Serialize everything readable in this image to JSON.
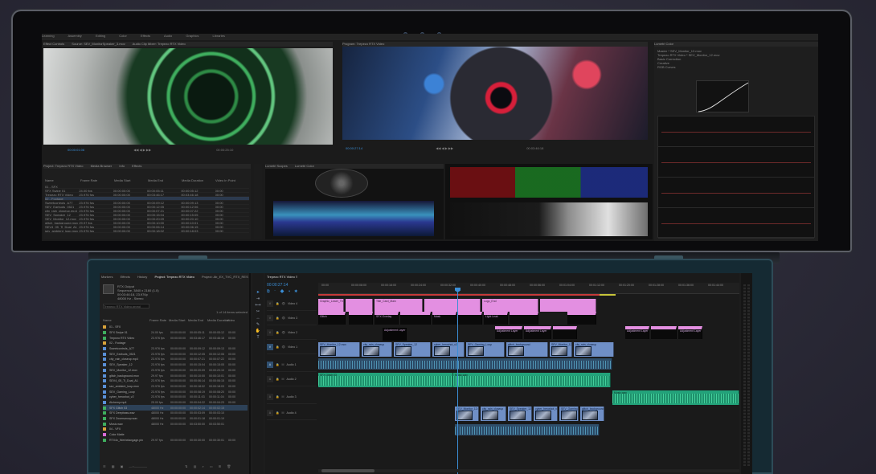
{
  "top_screen": {
    "menu_items": [
      "Learning",
      "Assembly",
      "Editing",
      "Color",
      "Effects",
      "Audio",
      "Graphics",
      "Libraries"
    ],
    "source_tabs": [
      "Effect Controls",
      "Source: SEV_MonitorSpeaker_3.mov",
      "Audio Clip Mixer: Trepezo RTX Video"
    ],
    "program_tab": "Program: Trepezo RTX Video",
    "source_timecode": "00:00:01:06",
    "source_end": "00:00:25:10",
    "program_timecode": "00:00:27:14",
    "program_end": "00:03:46:18",
    "lumetri_tab": "Lumetri Color",
    "lumetri_fields": [
      "Master * SEV_Monitor_12.mov",
      "Trepezo RTX Video * SEV_Monitor_12.mov",
      "Basic Correction",
      "Creative",
      "RGB Curves"
    ],
    "project_tabs": [
      "Project: Trepezo RTX Video",
      "Media Browser",
      "Info",
      "Effects"
    ],
    "project_columns": [
      "Name",
      "Frame Rate",
      "Media Start",
      "Media End",
      "Media Duration",
      "Video In Point"
    ],
    "scopes_tabs": [
      "Lumetri Scopes",
      "Lumetri Color"
    ]
  },
  "project": {
    "tabs": [
      "Markers",
      "Effects",
      "History",
      "Project: Trepezo RTX Video",
      "Project: Ab_EX_TVC_RTX_RES"
    ],
    "active_tab": 3,
    "info_lines": [
      "RTX Output",
      "Sequence, 3840 x 2160 (1.0)",
      "00:03:46:18, 23.976p",
      "48000 Hz - Stereo"
    ],
    "search_placeholder": "Trepezo RTX Video.prproj",
    "item_count": "1 of 14 items selected",
    "columns": [
      "Name",
      "Frame Rate",
      "Media Start",
      "Media End",
      "Media Duration",
      "Video"
    ],
    "rows": [
      {
        "name": "01 - SFX",
        "fr": "",
        "ms": "",
        "me": "",
        "md": "",
        "v": "",
        "color": "#d9a23a",
        "sel": false
      },
      {
        "name": "SFX Swipe 01",
        "fr": "24.00 fps",
        "ms": "00:00:00:00",
        "me": "00:00:05:11",
        "md": "00:00:05:12",
        "v": "00:00",
        "color": "#3fae5e",
        "sel": false
      },
      {
        "name": "Trepezo RTX Video",
        "fr": "23.976 fps",
        "ms": "00:00:00:00",
        "me": "00:03:46:17",
        "md": "00:03:46:18",
        "v": "00:00",
        "color": "#3fae5e",
        "sel": false
      },
      {
        "name": "02 - Footage",
        "fr": "",
        "ms": "",
        "me": "",
        "md": "",
        "v": "",
        "color": "#d9a23a",
        "sel": false
      },
      {
        "name": "Sweetcontrols_A77",
        "fr": "23.976 fps",
        "ms": "00:00:00:00",
        "me": "00:00:09:12",
        "md": "00:00:09:13",
        "v": "00:00",
        "color": "#5a8fd6",
        "sel": false
      },
      {
        "name": "SEV_Earbuds_0521",
        "fr": "23.976 fps",
        "ms": "00:00:00:00",
        "me": "00:00:12:05",
        "md": "00:00:12:06",
        "v": "00:00",
        "color": "#5a8fd6",
        "sel": false
      },
      {
        "name": "city_rain_closeup.mp4",
        "fr": "23.976 fps",
        "ms": "00:00:00:00",
        "me": "00:00:07:21",
        "md": "00:00:07:22",
        "v": "00:00",
        "color": "#5a8fd6",
        "sel": false
      },
      {
        "name": "SEV_Speaker_12",
        "fr": "23.976 fps",
        "ms": "00:00:00:00",
        "me": "00:00:15:04",
        "md": "00:00:15:05",
        "v": "00:00",
        "color": "#5a8fd6",
        "sel": false
      },
      {
        "name": "SEV_Monitor_12.mov",
        "fr": "23.976 fps",
        "ms": "00:00:00:00",
        "me": "00:00:20:09",
        "md": "00:00:20:10",
        "v": "00:00",
        "color": "#5a8fd6",
        "sel": false
      },
      {
        "name": "glitch_background.mov",
        "fr": "29.97 fps",
        "ms": "00:00:00:00",
        "me": "00:00:10:00",
        "md": "00:00:10:01",
        "v": "00:00",
        "color": "#5a8fd6",
        "sel": false
      },
      {
        "name": "SEV4_05_Ti_Dual_A1",
        "fr": "23.976 fps",
        "ms": "00:00:00:00",
        "me": "00:00:06:14",
        "md": "00:00:06:15",
        "v": "00:00",
        "color": "#5a8fd6",
        "sel": false
      },
      {
        "name": "sev_ambient_loop.mov",
        "fr": "23.976 fps",
        "ms": "00:00:00:00",
        "me": "00:00:18:02",
        "md": "00:00:18:03",
        "v": "00:00",
        "color": "#5a8fd6",
        "sel": false
      },
      {
        "name": "SEV_Gaming_Loop",
        "fr": "23.976 fps",
        "ms": "00:00:00:00",
        "me": "00:00:08:19",
        "md": "00:00:08:20",
        "v": "00:00",
        "color": "#5a8fd6",
        "sel": false
      },
      {
        "name": "cyber_heroshot_v2",
        "fr": "23.976 fps",
        "ms": "00:00:00:00",
        "me": "00:00:11:03",
        "md": "00:00:11:04",
        "v": "00:00",
        "color": "#5a8fd6",
        "sel": false
      },
      {
        "name": "Alchemy.mp4",
        "fr": "25.00 fps",
        "ms": "00:00:00:00",
        "me": "00:00:04:22",
        "md": "00:00:04:23",
        "v": "00:00",
        "color": "#5a8fd6",
        "sel": false
      },
      {
        "name": "SFX Glitch 03",
        "fr": "48000 Hz",
        "ms": "00:00:00:00",
        "me": "00:00:02:14",
        "md": "00:00:02:15",
        "v": "",
        "color": "#3fae5e",
        "sel": true
      },
      {
        "name": "SFX Deepbass.wav",
        "fr": "48000 Hz",
        "ms": "00:00:00:00",
        "me": "00:00:03:09",
        "md": "00:00:03:10",
        "v": "",
        "color": "#3fae5e",
        "sel": false
      },
      {
        "name": "SFX Zoomswoop.wav",
        "fr": "48000 Hz",
        "ms": "00:00:00:00",
        "me": "00:00:01:18",
        "md": "00:00:01:19",
        "v": "",
        "color": "#3fae5e",
        "sel": false
      },
      {
        "name": "Music.wav",
        "fr": "48000 Hz",
        "ms": "00:00:00:00",
        "me": "00:03:50:00",
        "md": "00:03:50:01",
        "v": "",
        "color": "#3fae5e",
        "sel": false
      },
      {
        "name": "04 - VFX",
        "fr": "",
        "ms": "",
        "me": "",
        "md": "",
        "v": "",
        "color": "#d9a23a",
        "sel": false
      },
      {
        "name": "Color Matte",
        "fr": "",
        "ms": "",
        "me": "",
        "md": "",
        "v": "",
        "color": "#d86ad6",
        "sel": false
      },
      {
        "name": "RTX4x_Werbelangage.ptx",
        "fr": "29.97 fps",
        "ms": "00:00:00:00",
        "me": "00:00:30:00",
        "md": "00:00:30:01",
        "v": "00:00",
        "color": "#3fae5e",
        "sel": false
      }
    ],
    "footer_icons": [
      "list-view-icon",
      "icon-view-icon",
      "freeform-view-icon",
      "zoom-slider-icon",
      "sort-icon",
      "automate-icon",
      "search-bins-icon",
      "new-bin-icon",
      "new-item-icon",
      "trash-icon"
    ],
    "status": "Select a clip to begin editing"
  },
  "timeline": {
    "tabs": [
      "Trepezo RTX Video"
    ],
    "timecode": "00:00:27:14",
    "ruler": [
      "00:00",
      "00:00:08:00",
      "00:00:16:00",
      "00:00:24:00",
      "00:00:32:00",
      "00:00:40:00",
      "00:00:48:00",
      "00:00:56:00",
      "00:01:04:00",
      "00:01:12:00",
      "00:01:20:00",
      "00:01:28:00",
      "00:01:36:00",
      "00:01:44:00"
    ],
    "video_tracks": [
      "Video 4",
      "Video 3",
      "Video 2",
      "Video 1"
    ],
    "audio_tracks": [
      "Audio 1",
      "Audio 2",
      "Audio 3",
      "Audio 4"
    ],
    "v4_clips": [
      "Graphic_Lower_Third",
      "Title_Card_Main",
      "Logo_End"
    ],
    "v3_labels": [
      "Glitch",
      "SFX Overlay",
      "Mask",
      "Light Leak"
    ],
    "v2_labels": [
      "Adjustment Layer",
      "Adjustment Layer",
      "Adjustment Layer",
      "Adjustment Layer",
      "Adjustment Layer"
    ],
    "v1_clips": [
      "SEV_Monitor_12.mov",
      "city_rain_closeup",
      "SEV_Speaker_12",
      "cyber_heroshot_v2",
      "SEV_Gaming_Loop",
      "glitch_background"
    ],
    "a_clips": [
      "SFX Glitch 03",
      "Music.wav",
      "Music.wav"
    ]
  },
  "tools": [
    "selection",
    "track-select",
    "ripple",
    "razor",
    "slip",
    "pen",
    "hand",
    "type"
  ]
}
